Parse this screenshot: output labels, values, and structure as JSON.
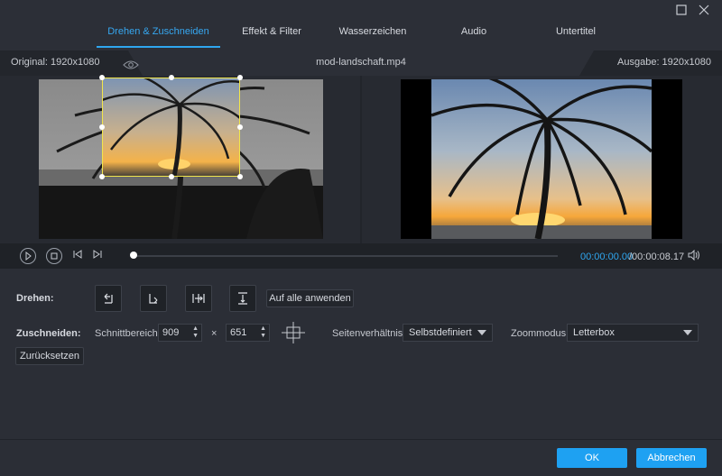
{
  "window": {
    "maximize_icon": "square-icon",
    "close_icon": "close-icon"
  },
  "tabs": [
    {
      "label": "Drehen & Zuschneiden",
      "active": true
    },
    {
      "label": "Effekt & Filter",
      "active": false
    },
    {
      "label": "Wasserzeichen",
      "active": false
    },
    {
      "label": "Audio",
      "active": false
    },
    {
      "label": "Untertitel",
      "active": false
    }
  ],
  "preview": {
    "original_label": "Original: 1920x1080",
    "filename": "mod-landschaft.mp4",
    "output_label": "Ausgabe: 1920x1080"
  },
  "playback": {
    "current_time": "00:00:00.00",
    "total_time": "/00:00:08.17",
    "progress": 0
  },
  "rotate": {
    "label": "Drehen:",
    "tools": [
      "rotate-left",
      "rotate-right",
      "flip-horizontal",
      "flip-vertical"
    ],
    "apply_all": "Auf alle anwenden"
  },
  "crop": {
    "label": "Zuschneiden:",
    "area_label": "Schnittbereich:",
    "width": "909",
    "times": "×",
    "height": "651",
    "ratio_label": "Seitenverhältnis:",
    "ratio_value": "Selbstdefiniert",
    "zoom_label": "Zoommodus:",
    "zoom_value": "Letterbox",
    "reset": "Zurücksetzen"
  },
  "footer": {
    "ok": "OK",
    "cancel": "Abbrechen"
  },
  "colors": {
    "accent": "#1ea1f2",
    "time_current": "#2fa6ef",
    "crop_border": "#f2e64a"
  }
}
